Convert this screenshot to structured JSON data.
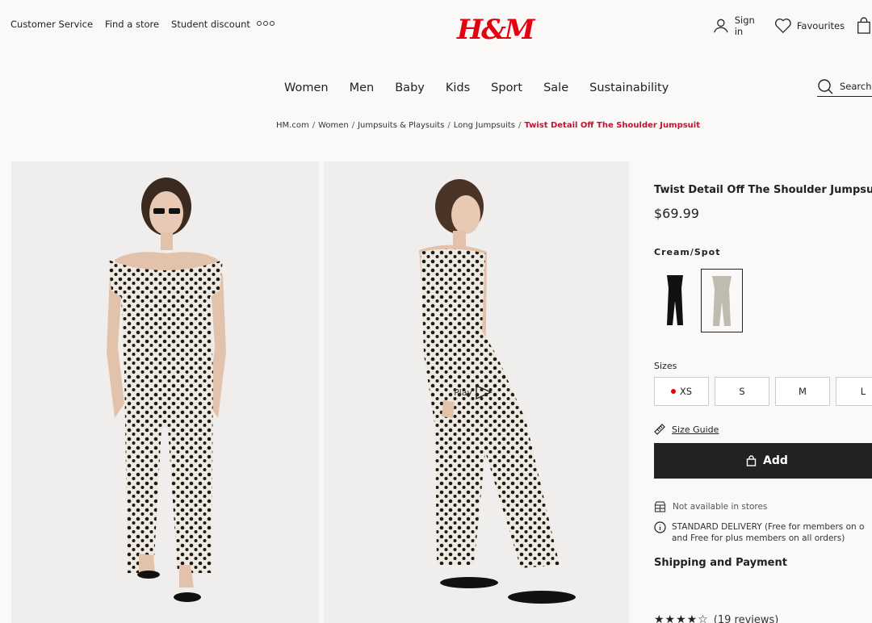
{
  "header": {
    "top_links": [
      "Customer Service",
      "Find a store",
      "Student discount"
    ],
    "more_icon": "more-dots-icon",
    "logo": "H&M",
    "sign_in": "Sign in",
    "favourites": "Favourites"
  },
  "nav": {
    "items": [
      "Women",
      "Men",
      "Baby",
      "Kids",
      "Sport",
      "Sale",
      "Sustainability"
    ],
    "search_label": "Search"
  },
  "breadcrumb": {
    "items": [
      "HM.com",
      "Women",
      "Jumpsuits & Playsuits",
      "Long Jumpsuits"
    ],
    "current": "Twist Detail Off The Shoulder Jumpsuit"
  },
  "gallery": {
    "video_label": "Play"
  },
  "product": {
    "title": "Twist Detail Off The Shoulder Jumpsuit",
    "price": "$69.99",
    "color_name": "Cream/Spot",
    "colors": [
      {
        "name": "Black",
        "hex": "#111111",
        "selected": false
      },
      {
        "name": "Cream/Spot",
        "hex": "#d9d4c8",
        "selected": true
      }
    ],
    "sizes_label": "Sizes",
    "sizes": [
      {
        "label": "XS",
        "low_stock": true
      },
      {
        "label": "S",
        "low_stock": false
      },
      {
        "label": "M",
        "low_stock": false
      },
      {
        "label": "L",
        "low_stock": false
      }
    ],
    "size_guide": "Size Guide",
    "add_label": "Add",
    "availability": "Not available in stores",
    "delivery_line1": "STANDARD DELIVERY (Free for members on o",
    "delivery_line2": "and Free for plus members on all orders)",
    "shipping": "Shipping and Payment",
    "rating_stars": "★★★★☆",
    "reviews": "(19 reviews)"
  },
  "colors": {
    "brand_red": "#e50010",
    "button_dark": "#222222"
  }
}
